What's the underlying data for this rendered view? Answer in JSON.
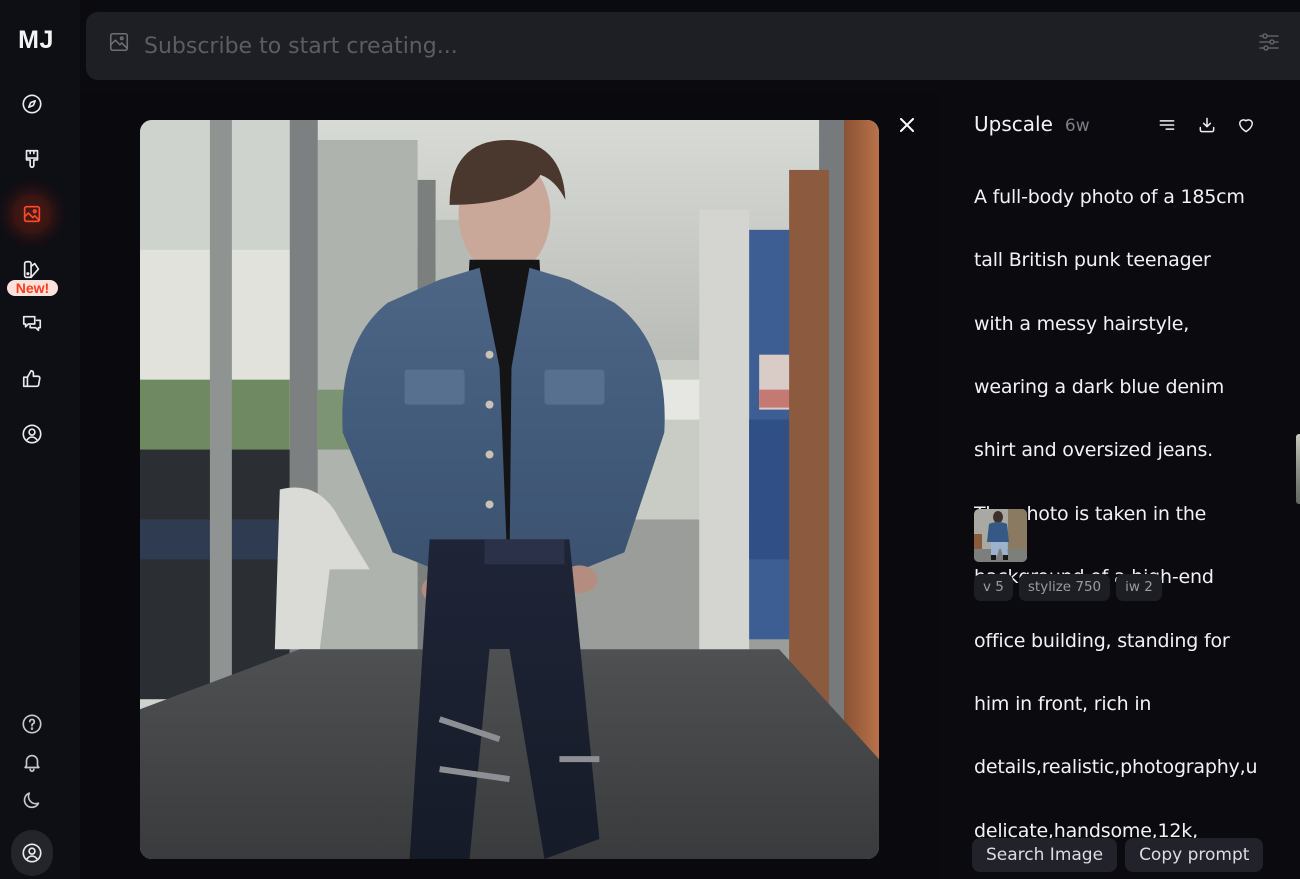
{
  "sidebar": {
    "logo": "MJ",
    "nav_items": [
      {
        "name": "explore",
        "icon": "compass-icon"
      },
      {
        "name": "create",
        "icon": "paintbrush-icon"
      },
      {
        "name": "organize",
        "icon": "image-icon",
        "active": true
      },
      {
        "name": "personalize",
        "icon": "swatch-icon",
        "badge": "New!"
      },
      {
        "name": "chat",
        "icon": "chat-bubbles-icon"
      },
      {
        "name": "rank",
        "icon": "thumbs-up-icon"
      },
      {
        "name": "profile",
        "icon": "user-circle-icon"
      }
    ],
    "bottom_items": [
      {
        "name": "help",
        "icon": "help-circle-icon"
      },
      {
        "name": "notifications",
        "icon": "bell-icon"
      },
      {
        "name": "dark-mode",
        "icon": "moon-icon"
      },
      {
        "name": "account",
        "icon": "account-circle-icon"
      }
    ],
    "new_badge": "New!",
    "accent_color": "#ff4a2a"
  },
  "prompt_bar": {
    "placeholder": "Subscribe to start creating...",
    "value": ""
  },
  "viewer": {
    "close_label": "close",
    "image_alt": "Full-body photo of a teenager in a denim jacket and ripped jeans standing in an office corridor"
  },
  "info": {
    "title": "Upscale",
    "age": "6w",
    "prompt": "A full-body photo of a 185cm tall British punk teenager with a messy hairstyle, wearing a dark blue denim shirt and oversized jeans. The photo is taken in the background of a high-end office building, standing for him in front, rich in details,realistic,photography,u delicate,handsome,12k,",
    "prompt_lines": [
      "A full-body photo of a 185cm",
      "tall British punk teenager",
      "with a messy hairstyle,",
      "wearing a dark blue denim",
      "shirt and oversized jeans.",
      "The photo is taken in the",
      "background of a high-end",
      "office building, standing for",
      "him in front, rich in",
      "details,realistic,photography,u",
      "delicate,handsome,12k,"
    ],
    "parameters": [
      "v 5",
      "stylize 750",
      "iw 2"
    ],
    "buttons": {
      "search_image": "Search Image",
      "copy_prompt": "Copy prompt"
    }
  }
}
